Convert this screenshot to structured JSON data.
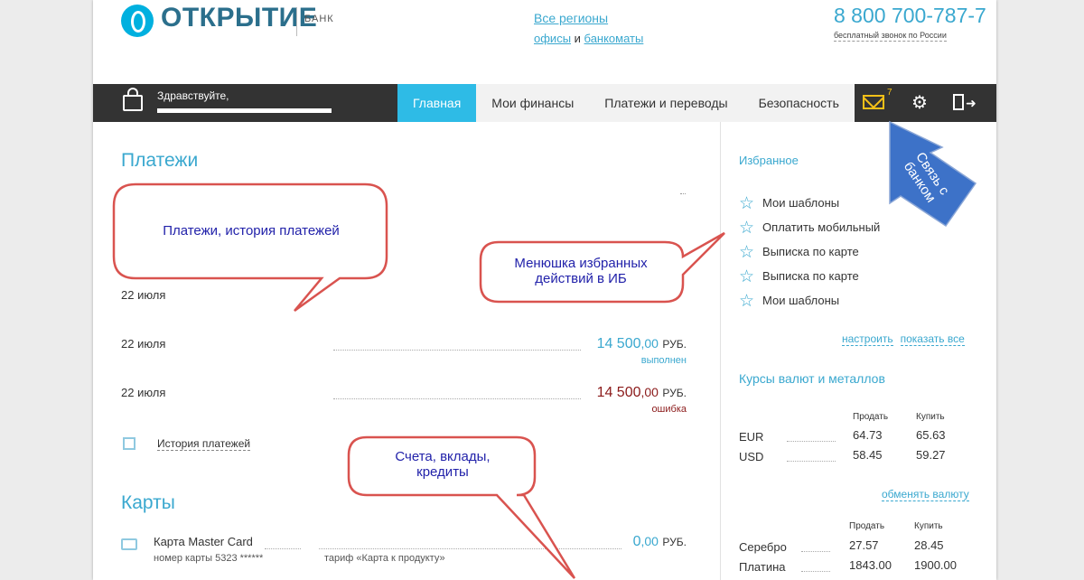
{
  "header": {
    "logo_text": "ОТКРЫТИЕ",
    "logo_bank": "БАНК",
    "regions": "Все регионы",
    "offices": "офисы",
    "offices_and": "и",
    "atms": "банкоматы",
    "phone": "8 800 700-787-7",
    "phone_note": "бесплатный звонок по России"
  },
  "nav": {
    "greeting": "Здравствуйте,",
    "tabs": [
      "Главная",
      "Мои финансы",
      "Платежи и переводы",
      "Безопасность"
    ],
    "mail_count": "7",
    "mail_icon": "envelope-icon",
    "gear_icon": "gear-icon",
    "logout_icon": "logout-icon",
    "accent": "#2ebbe6"
  },
  "payments": {
    "title": "Платежи",
    "rows": [
      {
        "date": "22 июля"
      },
      {
        "date": "22 июля",
        "amount_int": "14 500",
        "amount_dec": ",00",
        "currency": "РУБ.",
        "status": "выполнен",
        "color": "#3aa8cf"
      },
      {
        "date": "22 июля",
        "amount_int": "14 500",
        "amount_dec": ",00",
        "currency": "РУБ.",
        "status": "ошибка",
        "color": "#8b1a1a"
      }
    ],
    "history_link": "История платежей"
  },
  "cards": {
    "title": "Карты",
    "name": "Карта Master Card",
    "number": "номер карты 5323 ******",
    "tariff": "тариф «Карта к продукту»",
    "amount_int": "0",
    "amount_dec": ",00",
    "currency": "РУБ."
  },
  "favorites": {
    "title": "Избранное",
    "items": [
      "Мои шаблоны",
      "Оплатить мобильный",
      "Выписка по карте",
      "Выписка по карте",
      "Мои шаблоны"
    ],
    "configure": "настроить",
    "show_all": "показать все"
  },
  "rates": {
    "title": "Курсы валют и металлов",
    "sell": "Продать",
    "buy": "Купить",
    "currencies": [
      {
        "name": "EUR",
        "sell": "64.73",
        "buy": "65.63"
      },
      {
        "name": "USD",
        "sell": "58.45",
        "buy": "59.27"
      }
    ],
    "swap": "обменять валюту",
    "metals": [
      {
        "name": "Серебро",
        "sell": "27.57",
        "buy": "28.45"
      },
      {
        "name": "Платина",
        "sell": "1843.00",
        "buy": "1900.00"
      }
    ]
  },
  "annotations": {
    "payments": "Платежи, история платежей",
    "favorites": "Менюшка избранных действий в ИБ",
    "accounts": "Счета, вклады, кредиты",
    "bank_contact": "Связь с банком"
  }
}
